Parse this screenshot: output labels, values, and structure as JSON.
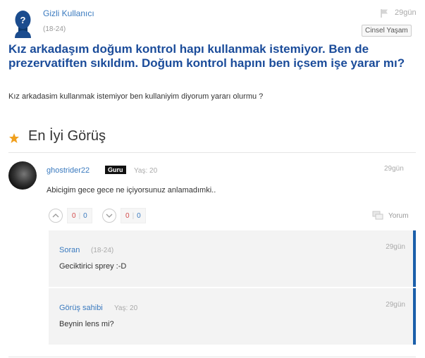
{
  "question": {
    "author": "Gizli Kullanıcı",
    "age": "(18-24)",
    "time": "29gün",
    "category": "Cinsel Yaşam",
    "title": "Kız arkadaşım doğum kontrol hapı kullanmak istemiyor. Ben de prezervatiften sıkıldım. Doğum kontrol hapını ben içsem işe yarar mı?",
    "body": "Kız arkadasim kullanmak istemiyor ben kullaniyim diyorum yararı olurmu ?"
  },
  "best_answer": {
    "section_title": "En İyi Görüş",
    "author": "ghostrider22",
    "badge": "Guru",
    "age": "Yaş: 20",
    "time": "29gün",
    "body": "Abicigim gece gece ne içiyorsunuz anlamadımki..",
    "upvote": {
      "red": "0",
      "blue": "0"
    },
    "downvote": {
      "red": "0",
      "blue": "0"
    },
    "comment_label": "Yorum",
    "colors": {
      "accent": "#1b5faa",
      "title": "#1b4c9a",
      "link": "#3a7abf",
      "star": "#f0a01e"
    }
  },
  "replies": [
    {
      "author": "Soran",
      "age": "(18-24)",
      "time": "29gün",
      "body": "Geciktirici sprey :-D"
    },
    {
      "author": "Görüş sahibi",
      "age": "Yaş: 20",
      "time": "29gün",
      "body": "Beynin lens mi?"
    }
  ]
}
